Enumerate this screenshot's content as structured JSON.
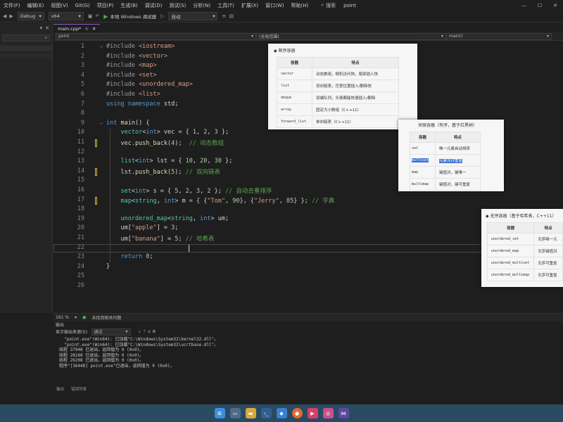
{
  "menubar": {
    "items": [
      "文件(F)",
      "编辑(E)",
      "视图(V)",
      "Git(G)",
      "项目(P)",
      "生成(B)",
      "调试(D)",
      "测试(S)",
      "分析(N)",
      "工具(T)",
      "扩展(X)",
      "窗口(W)",
      "帮助(H)"
    ],
    "search_label": "搜索",
    "project_name": "point"
  },
  "toolbar": {
    "config": "Debug",
    "platform": "x64",
    "run_label": "本地 Windows 调试器",
    "target": "自动"
  },
  "editor": {
    "tab_label": "main.cpp*",
    "nav": {
      "project": "point",
      "scope": "(全局范围)",
      "member": "main()"
    },
    "lines": [
      {
        "n": "1",
        "t": [
          [
            "pp",
            "#include "
          ],
          [
            "str",
            "<iostream>"
          ]
        ]
      },
      {
        "n": "2",
        "t": [
          [
            "pp",
            "#include "
          ],
          [
            "str",
            "<vector>"
          ]
        ]
      },
      {
        "n": "3",
        "t": [
          [
            "pp",
            "#include "
          ],
          [
            "str",
            "<map>"
          ]
        ]
      },
      {
        "n": "4",
        "t": [
          [
            "pp",
            "#include "
          ],
          [
            "str",
            "<set>"
          ]
        ]
      },
      {
        "n": "5",
        "t": [
          [
            "pp",
            "#include "
          ],
          [
            "str",
            "<unordered_map>"
          ]
        ]
      },
      {
        "n": "6",
        "t": [
          [
            "pp",
            "#include "
          ],
          [
            "str",
            "<list>"
          ]
        ]
      },
      {
        "n": "7",
        "t": [
          [
            "kw",
            "using namespace "
          ],
          [
            "",
            "std;"
          ]
        ]
      },
      {
        "n": "8",
        "t": []
      },
      {
        "n": "9",
        "t": [
          [
            "kw",
            "int "
          ],
          [
            "fn",
            "main"
          ],
          [
            "",
            "() {"
          ]
        ]
      },
      {
        "n": "10",
        "t": [
          [
            "",
            "    "
          ],
          [
            "ty",
            "vector"
          ],
          [
            "",
            "<"
          ],
          [
            "kw",
            "int"
          ],
          [
            "",
            "> vec = { "
          ],
          [
            "num",
            "1"
          ],
          [
            "",
            ", "
          ],
          [
            "num",
            "2"
          ],
          [
            "",
            ", "
          ],
          [
            "num",
            "3"
          ],
          [
            "",
            " };"
          ]
        ]
      },
      {
        "n": "11",
        "t": [
          [
            "",
            "    vec."
          ],
          [
            "fn",
            "push_back"
          ],
          [
            "",
            "("
          ],
          [
            "num",
            "4"
          ],
          [
            "",
            ");  "
          ],
          [
            "cm",
            "// 动态数组"
          ]
        ]
      },
      {
        "n": "12",
        "t": []
      },
      {
        "n": "13",
        "t": [
          [
            "",
            "    "
          ],
          [
            "ty",
            "list"
          ],
          [
            "",
            "<"
          ],
          [
            "kw",
            "int"
          ],
          [
            "",
            "> lst = { "
          ],
          [
            "num",
            "10"
          ],
          [
            "",
            ", "
          ],
          [
            "num",
            "20"
          ],
          [
            "",
            ", "
          ],
          [
            "num",
            "30"
          ],
          [
            "",
            " };"
          ]
        ]
      },
      {
        "n": "14",
        "t": [
          [
            "",
            "    lst."
          ],
          [
            "fn",
            "push_back"
          ],
          [
            "",
            "("
          ],
          [
            "num",
            "5"
          ],
          [
            "",
            "); "
          ],
          [
            "cm",
            "// 双向链表"
          ]
        ]
      },
      {
        "n": "15",
        "t": []
      },
      {
        "n": "16",
        "t": [
          [
            "",
            "    "
          ],
          [
            "ty",
            "set"
          ],
          [
            "",
            "<"
          ],
          [
            "kw",
            "int"
          ],
          [
            "",
            "> s = { "
          ],
          [
            "num",
            "5"
          ],
          [
            "",
            ", "
          ],
          [
            "num",
            "2"
          ],
          [
            "",
            ", "
          ],
          [
            "num",
            "3"
          ],
          [
            "",
            ", "
          ],
          [
            "num",
            "2"
          ],
          [
            "",
            " }; "
          ],
          [
            "cm",
            "// 自动去重排序"
          ]
        ]
      },
      {
        "n": "17",
        "t": [
          [
            "",
            "    "
          ],
          [
            "ty",
            "map"
          ],
          [
            "",
            "<"
          ],
          [
            "ty",
            "string"
          ],
          [
            "",
            ", "
          ],
          [
            "kw",
            "int"
          ],
          [
            "",
            "> m = { {"
          ],
          [
            "str",
            "\"Tom\""
          ],
          [
            "",
            ", "
          ],
          [
            "num",
            "90"
          ],
          [
            "",
            "}, {"
          ],
          [
            "str",
            "\"Jerry\""
          ],
          [
            "",
            ", "
          ],
          [
            "num",
            "85"
          ],
          [
            "",
            "} }; "
          ],
          [
            "cm",
            "// 字典"
          ]
        ]
      },
      {
        "n": "18",
        "t": []
      },
      {
        "n": "19",
        "t": [
          [
            "",
            "    "
          ],
          [
            "ty",
            "unordered_map"
          ],
          [
            "",
            "<"
          ],
          [
            "ty",
            "string"
          ],
          [
            "",
            ", "
          ],
          [
            "kw",
            "int"
          ],
          [
            "",
            "> um;"
          ]
        ]
      },
      {
        "n": "20",
        "t": [
          [
            "",
            "    um["
          ],
          [
            "str",
            "\"apple\""
          ],
          [
            "",
            "] = "
          ],
          [
            "num",
            "3"
          ],
          [
            "",
            ";"
          ]
        ]
      },
      {
        "n": "21",
        "t": [
          [
            "",
            "    um["
          ],
          [
            "str",
            "\"banana\""
          ],
          [
            "",
            "] = "
          ],
          [
            "num",
            "5"
          ],
          [
            "",
            "; "
          ],
          [
            "cm",
            "// 哈希表"
          ]
        ]
      },
      {
        "n": "22",
        "t": []
      },
      {
        "n": "23",
        "t": [
          [
            "",
            "    "
          ],
          [
            "kw",
            "return "
          ],
          [
            "num",
            "0"
          ],
          [
            "",
            ";"
          ]
        ]
      },
      {
        "n": "24",
        "t": [
          [
            "",
            "}"
          ]
        ]
      },
      {
        "n": "25",
        "t": []
      },
      {
        "n": "26",
        "t": []
      }
    ]
  },
  "popup1": {
    "title": "顺序容器",
    "headers": [
      "容器",
      "特点"
    ],
    "rows": [
      [
        "vector",
        "动态数组，随机访问快，尾部插入快"
      ],
      [
        "list",
        "双向链表，任意位置插入/删除快"
      ],
      [
        "deque",
        "双端队列，头尾都能快速插入/删除"
      ],
      [
        "array",
        "固定大小数组（C++11）"
      ],
      [
        "forward_list",
        "单向链表（C++11）"
      ]
    ]
  },
  "popup2": {
    "title": "关联容器（有序，基于红黑树）",
    "headers": [
      "容器",
      "特点"
    ],
    "rows": [
      [
        "set",
        "唯一元素自动排序"
      ],
      [
        "multiset",
        "元素允许重复"
      ],
      [
        "map",
        "键值对，键唯一"
      ],
      [
        "multimap",
        "键值对，键可重复"
      ]
    ]
  },
  "popup3": {
    "title": "无序容器（基于哈希表，C++11）",
    "headers": [
      "容器",
      "特点"
    ],
    "rows": [
      [
        "unordered_set",
        "无序唯一元"
      ],
      [
        "unordered_map",
        "无序键值对"
      ],
      [
        "unordered_multiset",
        "无序可重复"
      ],
      [
        "unordered_multimap",
        "无序可重复"
      ]
    ]
  },
  "status": {
    "zoom": "161 %",
    "issues": "未找到相关问题"
  },
  "output": {
    "header": "输出",
    "source_label": "显示输出来源(S):",
    "source_value": "调试",
    "lines": [
      "  \"point.exe\"(Win64): 已加载\"C:\\Windows\\System32\\kernel32.dll\"。",
      "  \"point.exe\"(Win64): 已加载\"C:\\Windows\\System32\\ucrtbase.dll\"。",
      "线程 37948 已退出，返回值为 0 (0x0)。",
      "线程 28160 已退出，返回值为 0 (0x0)。",
      "线程 26208 已退出，返回值为 0 (0x0)。",
      "程序\"[36448] point.exe\"已退出，返回值为 0 (0x0)。"
    ]
  },
  "bottom_tabs": [
    "输出",
    "错误列表"
  ]
}
